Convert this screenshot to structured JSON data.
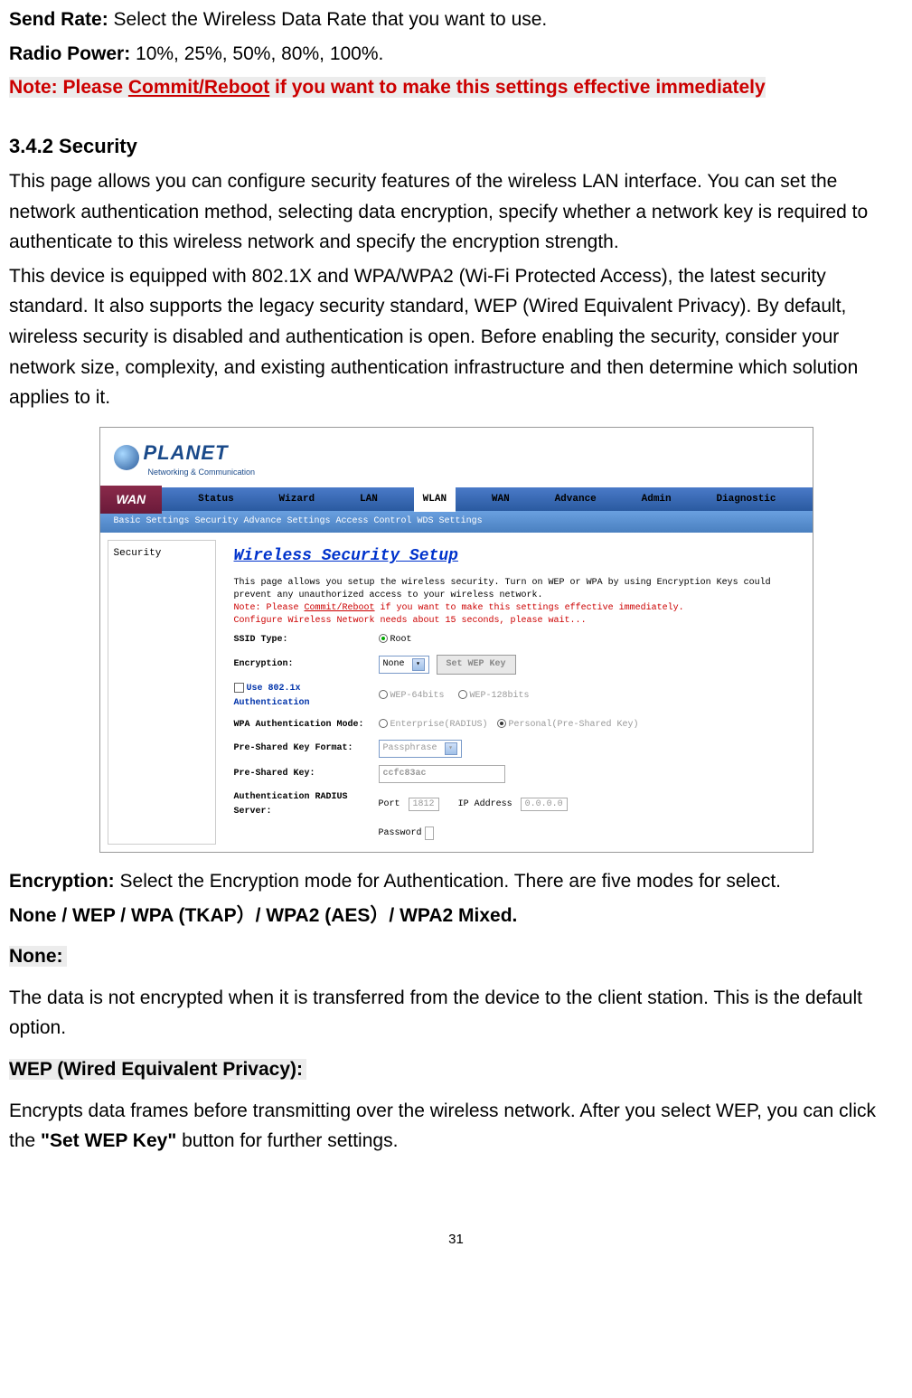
{
  "body": {
    "sendRateLabel": "Send Rate:",
    "sendRateText": " Select the Wireless Data Rate that you want to use.",
    "radioPowerLabel": "Radio Power:",
    "radioPowerText": " 10%, 25%, 50%, 80%, 100%.",
    "notePrefix": "Note: Please ",
    "noteLink": "Commit/Reboot",
    "noteSuffix": " if you want to make this settings effective immediately",
    "secHeading": "3.4.2 Security",
    "secPara1": "This page allows you can configure security features of the wireless LAN interface. You can set the network authentication method, selecting data encryption, specify whether a network key is required to authenticate to this wireless network and specify the encryption strength.",
    "secPara2": "This device is equipped with 802.1X and WPA/WPA2 (Wi-Fi Protected Access), the latest security standard. It also supports the legacy security standard, WEP (Wired Equivalent Privacy). By default, wireless security is disabled and authentication is open. Before enabling the security, consider your network size, complexity, and existing authentication infrastructure and then determine which solution applies to it.",
    "encLabel": "Encryption:",
    "encText": " Select the Encryption mode for Authentication. There are five modes for select.",
    "encModes": "None / WEP / WPA (TKAP）/ WPA2 (AES）/ WPA2 Mixed.",
    "noneLabel": "None:  ",
    "noneText": "The data is not encrypted when it is transferred from the device to the client station. This is the default option.",
    "wepLabel": "WEP (Wired Equivalent Privacy):  ",
    "wepText1": "Encrypts data frames before transmitting over the wireless network. After you select WEP, you can click the ",
    "wepBold": "\"Set WEP Key\"",
    "wepText2": " button for further settings.",
    "pageNum": "31"
  },
  "screenshot": {
    "brand": "PLANET",
    "tagline": "Networking & Communication",
    "wanBtn": "WAN",
    "nav": [
      "Status",
      "Wizard",
      "LAN",
      "WLAN",
      "WAN",
      "Advance",
      "Admin",
      "Diagnostic"
    ],
    "subtabs": "Basic Settings  Security  Advance Settings  Access Control  WDS Settings",
    "sidebar": "Security",
    "panelTitle": "Wireless Security Setup",
    "desc1": "This page allows you setup the wireless security. Turn on WEP or WPA by using Encryption Keys could prevent any unauthorized access to your wireless network.",
    "descNote1": "Note: Please ",
    "descNoteLink": "Commit/Reboot",
    "descNote2": " if you want to make this settings effective immediately.",
    "descWarn": "Configure Wireless Network needs about 15 seconds, please wait...",
    "labels": {
      "ssid": "SSID Type:",
      "ssidVal": "Root",
      "enc": "Encryption:",
      "encVal": "None",
      "wepBtn": "Set WEP Key",
      "use8021x": "Use 802.1x Authentication",
      "wep64": "WEP-64bits",
      "wep128": "WEP-128bits",
      "wpaAuth": "WPA Authentication Mode:",
      "enterprise": "Enterprise(RADIUS)",
      "personal": "Personal(Pre-Shared Key)",
      "pskFmt": "Pre-Shared Key Format:",
      "pskFmtVal": "Passphrase",
      "psk": "Pre-Shared Key:",
      "pskVal": "ccfc83ac",
      "radius": "Authentication RADIUS Server:",
      "port": "Port",
      "portVal": "1812",
      "ip": "IP Address",
      "ipVal": "0.0.0.0",
      "password": "Password"
    }
  }
}
